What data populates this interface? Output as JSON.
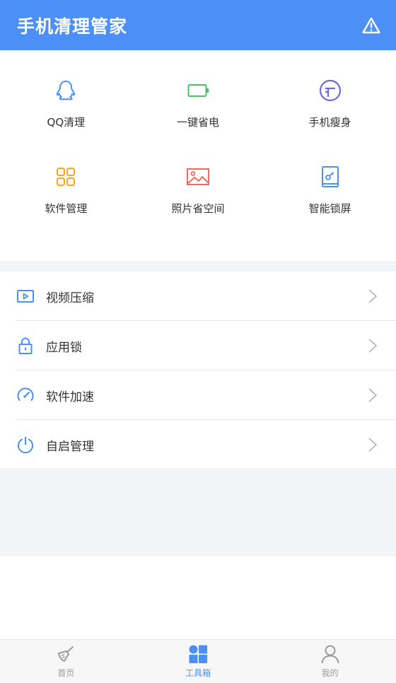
{
  "header": {
    "title": "手机清理管家",
    "warning_icon": "warning-triangle-icon"
  },
  "grid": {
    "items": [
      {
        "label": "QQ清理",
        "icon": "qq-penguin-icon",
        "color": "#4c8ff6"
      },
      {
        "label": "一键省电",
        "icon": "battery-icon",
        "color": "#4cbf6f"
      },
      {
        "label": "手机瘦身",
        "icon": "slim-circle-icon",
        "color": "#6c6ad6"
      },
      {
        "label": "软件管理",
        "icon": "apps-grid-icon",
        "color": "#f5a623"
      },
      {
        "label": "照片省空间",
        "icon": "image-icon",
        "color": "#ef6b5f"
      },
      {
        "label": "智能锁屏",
        "icon": "lock-screen-icon",
        "color": "#4c8ff6"
      }
    ]
  },
  "list": {
    "items": [
      {
        "label": "视频压缩",
        "icon": "video-icon"
      },
      {
        "label": "应用锁",
        "icon": "lock-icon"
      },
      {
        "label": "软件加速",
        "icon": "speedometer-icon"
      },
      {
        "label": "自启管理",
        "icon": "power-icon"
      }
    ]
  },
  "bottom_nav": {
    "items": [
      {
        "label": "首页",
        "icon": "broom-icon",
        "active": false
      },
      {
        "label": "工具箱",
        "icon": "toolbox-grid-icon",
        "active": true
      },
      {
        "label": "我的",
        "icon": "user-icon",
        "active": false
      }
    ]
  },
  "colors": {
    "primary": "#4c8ff6",
    "inactive": "#9a9a9a",
    "divider": "#e5e5e5"
  }
}
